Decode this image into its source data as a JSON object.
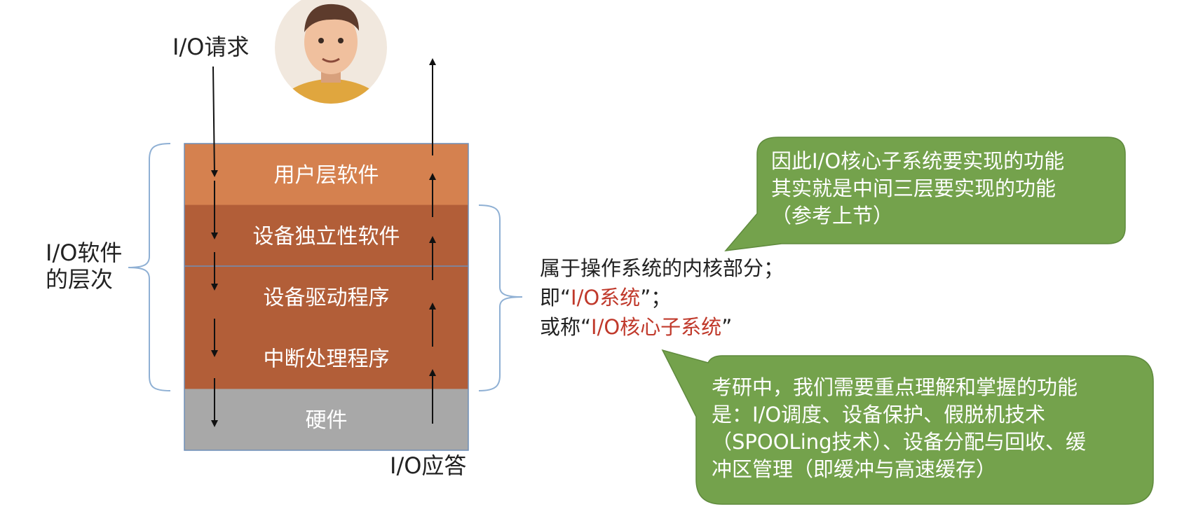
{
  "io_request_label": "I/O请求",
  "io_response_label": "I/O应答",
  "software_levels_label": [
    "I/O软件",
    "的层次"
  ],
  "layers": [
    {
      "name": "用户层软件",
      "color": "#d5814f"
    },
    {
      "name": "设备独立性软件",
      "color": "#b25e38"
    },
    {
      "name": "设备驱动程序",
      "color": "#b25e38"
    },
    {
      "name": "中断处理程序",
      "color": "#b25e38"
    },
    {
      "name": "硬件",
      "color": "#a8a8a8"
    }
  ],
  "kernel_note": {
    "line1": "属于操作系统的内核部分；",
    "line2_prefix": "即“",
    "line2_highlight": "I/O系统",
    "line2_suffix": "”；",
    "line3_prefix": "或称“",
    "line3_highlight": "I/O核心子系统",
    "line3_suffix": "”",
    "highlight_color": "#c0392b"
  },
  "callout_top": {
    "lines": [
      "因此I/O核心子系统要实现的功能",
      "其实就是中间三层要实现的功能",
      "（参考上节）"
    ],
    "color": "#74a24c"
  },
  "callout_bottom": {
    "lines": [
      "考研中，我们需要重点理解和掌握的功能",
      "是：I/O调度、设备保护、假脱机技术",
      "（SPOOLing技术）、设备分配与回收、缓",
      "冲区管理（即缓冲与高速缓存）"
    ],
    "color": "#74a24c"
  },
  "bracket_color": "#8fb0d4"
}
